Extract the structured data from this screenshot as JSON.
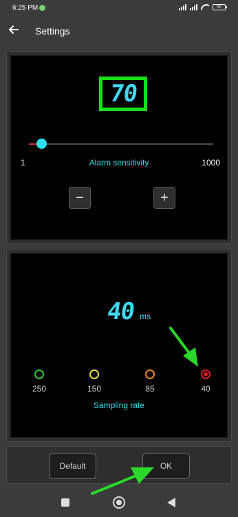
{
  "status_bar": {
    "time": "6:25 PM",
    "battery": "66"
  },
  "app_bar": {
    "title": "Settings",
    "back_icon": "arrow-left-icon"
  },
  "alarm": {
    "value": "70",
    "slider_min": "1",
    "slider_max": "1000",
    "slider_value": 70,
    "caption": "Alarm sensitivity",
    "minus_label": "−",
    "plus_label": "+"
  },
  "sampling": {
    "value": "40",
    "unit": "ms",
    "caption": "Sampling rate",
    "options": [
      {
        "label": "250",
        "color": "#33cc33",
        "selected": false
      },
      {
        "label": "150",
        "color": "#e8e040",
        "selected": false
      },
      {
        "label": "85",
        "color": "#f08a20",
        "selected": false
      },
      {
        "label": "40",
        "color": "#e02020",
        "selected": true
      }
    ]
  },
  "buttons": {
    "default_label": "Default",
    "ok_label": "OK"
  },
  "colors": {
    "digit": "#40d8f0",
    "highlight_box": "#19e019",
    "annotation_arrow": "#2ad82a"
  },
  "nav_bar": {
    "icons": [
      "recents-square-icon",
      "home-circle-icon",
      "back-triangle-icon"
    ]
  }
}
